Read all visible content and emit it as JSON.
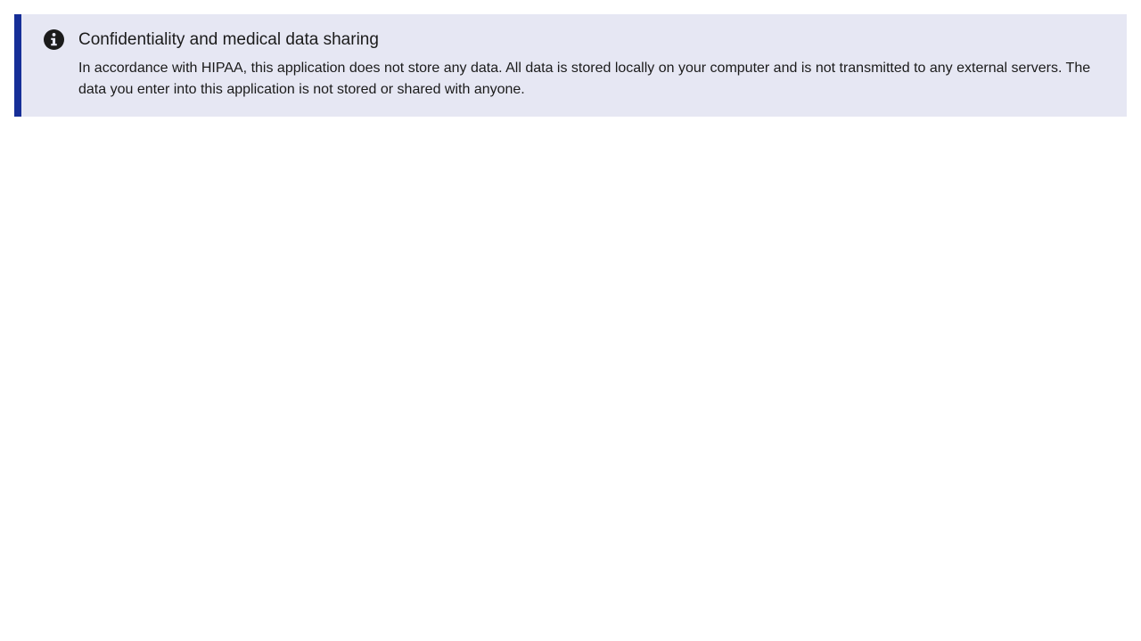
{
  "alert": {
    "icon": "info-circle-icon",
    "accent_color": "#162e97",
    "background_color": "#e6e7f3",
    "heading": "Confidentiality and medical data sharing",
    "text": "In accordance with HIPAA, this application does not store any data. All data is stored locally on your computer and is not transmitted to any external servers. The data you enter into this application is not stored or shared with anyone."
  }
}
